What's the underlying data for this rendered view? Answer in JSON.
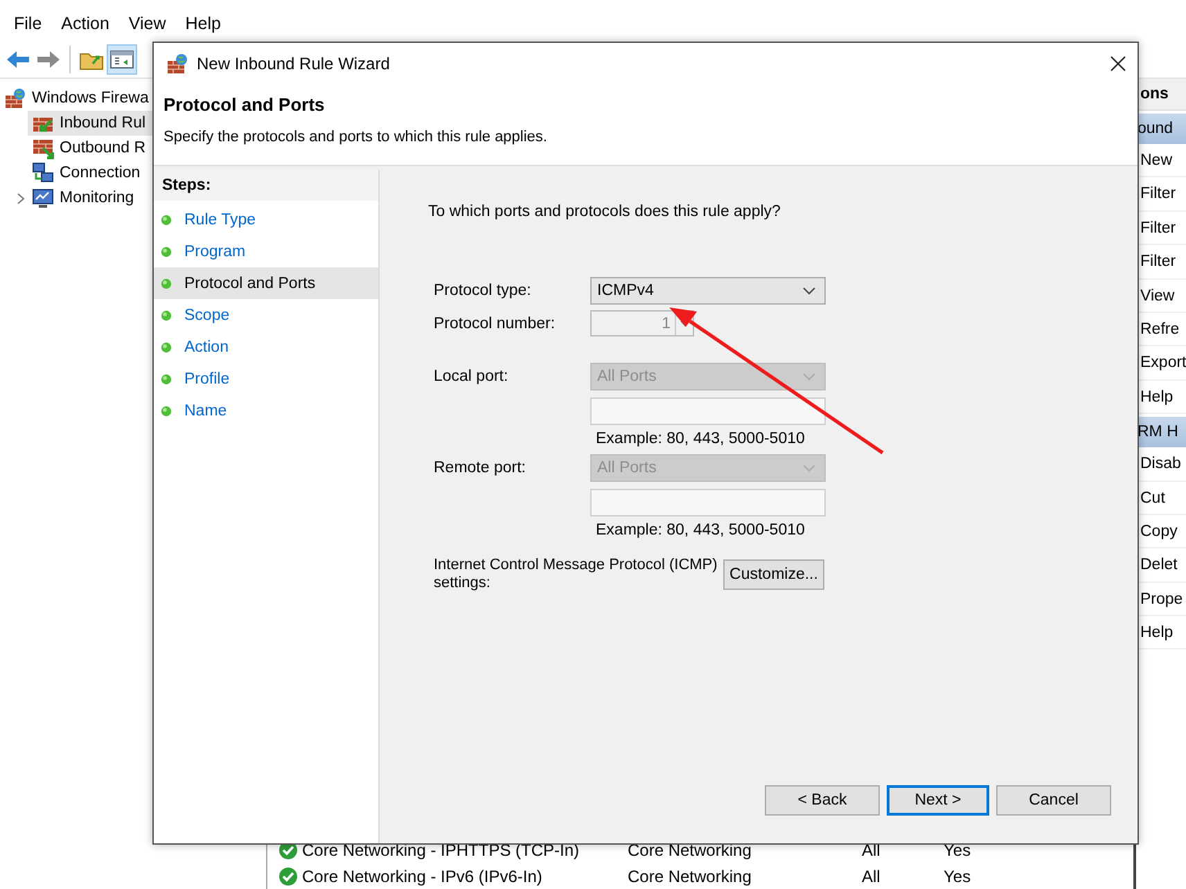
{
  "menu_bar": [
    "File",
    "Action",
    "View",
    "Help"
  ],
  "tree": [
    {
      "label": "Windows Firewa",
      "kind": "firewall",
      "expandable": false,
      "selected": false,
      "children": [
        {
          "label": "Inbound Rul",
          "kind": "inbound",
          "expandable": false,
          "selected": true
        },
        {
          "label": "Outbound R",
          "kind": "outbound",
          "expandable": false,
          "selected": false
        },
        {
          "label": "Connection",
          "kind": "connection",
          "expandable": false,
          "selected": false
        },
        {
          "label": "Monitoring",
          "kind": "monitoring",
          "expandable": true,
          "selected": false
        }
      ]
    }
  ],
  "actions": {
    "title": "ons",
    "sections": [
      {
        "header": "ound",
        "items": [
          "New",
          "Filter",
          "Filter",
          "Filter",
          "View",
          "Refre",
          "Export",
          "Help"
        ]
      },
      {
        "header": "RM H",
        "items": [
          "Disab",
          "Cut",
          "Copy",
          "Delet",
          "Prope",
          "Help"
        ]
      }
    ]
  },
  "rules": [
    {
      "name": "Core Networking - IPHTTPS (TCP-In)",
      "group": "Core Networking",
      "profile": "All",
      "enabled": "Yes"
    },
    {
      "name": "Core Networking - IPv6 (IPv6-In)",
      "group": "Core Networking",
      "profile": "All",
      "enabled": "Yes"
    }
  ],
  "dialog": {
    "title": "New Inbound Rule Wizard",
    "heading": "Protocol and Ports",
    "subtitle": "Specify the protocols and ports to which this rule applies.",
    "steps_title": "Steps:",
    "steps": [
      {
        "label": "Rule Type",
        "selected": false
      },
      {
        "label": "Program",
        "selected": false
      },
      {
        "label": "Protocol and Ports",
        "selected": true
      },
      {
        "label": "Scope",
        "selected": false
      },
      {
        "label": "Action",
        "selected": false
      },
      {
        "label": "Profile",
        "selected": false
      },
      {
        "label": "Name",
        "selected": false
      }
    ],
    "question": "To which ports and protocols does this rule apply?",
    "protocol_type": {
      "label": "Protocol type:",
      "value": "ICMPv4",
      "disabled": false
    },
    "protocol_number": {
      "label": "Protocol number:",
      "value": "1",
      "disabled": true
    },
    "ports": [
      {
        "label": "Local port:",
        "value": "All Ports",
        "disabled": true,
        "example": "Example: 80, 443, 5000-5010"
      },
      {
        "label": "Remote port:",
        "value": "All Ports",
        "disabled": true,
        "example": "Example: 80, 443, 5000-5010"
      }
    ],
    "icmp": {
      "label": "Internet Control Message Protocol (ICMP) settings:",
      "button": "Customize..."
    },
    "buttons": [
      {
        "label": "< Back",
        "focused": false
      },
      {
        "label": "Next >",
        "focused": true
      },
      {
        "label": "Cancel",
        "focused": false
      }
    ]
  }
}
